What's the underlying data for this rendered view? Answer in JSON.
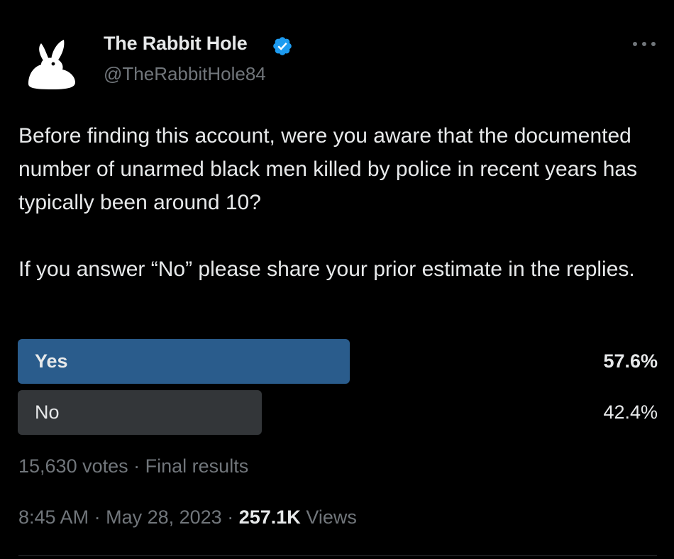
{
  "author": {
    "display_name": "The Rabbit Hole",
    "handle": "@TheRabbitHole84",
    "verified": true,
    "verified_color": "#1d9bf0"
  },
  "more_icon": "more-horizontal-icon",
  "tweet": {
    "paragraph_1": "Before finding this account, were you aware that the documented number of unarmed black men killed by police in recent years has typically been around 10?",
    "paragraph_2": "If you answer “No” please share your prior estimate in the replies."
  },
  "poll": {
    "options": [
      {
        "label": "Yes",
        "percent_text": "57.6%",
        "percent": 57.6,
        "winner": true,
        "bar_color": "#2a5c8c"
      },
      {
        "label": "No",
        "percent_text": "42.4%",
        "percent": 42.4,
        "winner": false,
        "bar_color": "#333639"
      }
    ],
    "votes_text": "15,630 votes",
    "separator": "·",
    "status_text": "Final results"
  },
  "meta": {
    "time": "8:45 AM",
    "separator": "·",
    "date": "May 28, 2023",
    "views_count": "257.1K",
    "views_label": "Views"
  }
}
